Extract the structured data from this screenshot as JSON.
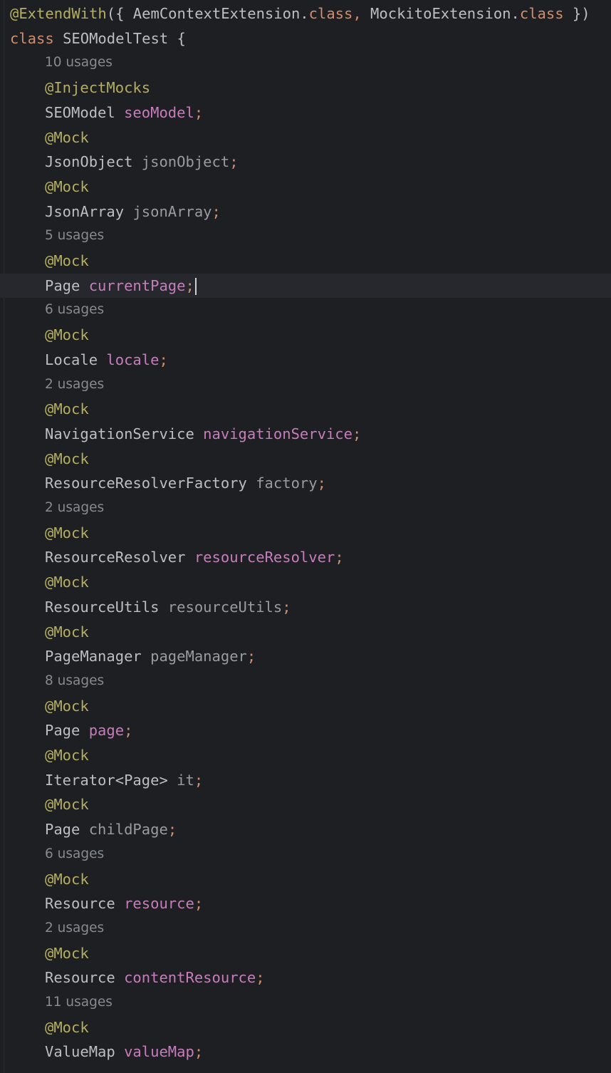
{
  "class_header": {
    "annotation": "@ExtendWith",
    "open": "({ ",
    "ext1": "AemContextExtension",
    "dot1": ".",
    "class_kw1": "class",
    "comma": ", ",
    "ext2": "MockitoExtension",
    "dot2": ".",
    "class_kw2": "class",
    "close": " })",
    "keyword": "class",
    "name": "SEOModelTest",
    "brace": " {"
  },
  "members": [
    {
      "hint": "10 usages",
      "annotation": "@InjectMocks",
      "type": "SEOModel",
      "name": "seoModel",
      "style": "field"
    },
    {
      "hint": "",
      "annotation": "@Mock",
      "type": "JsonObject",
      "name": "jsonObject",
      "style": "dim"
    },
    {
      "hint": "",
      "annotation": "@Mock",
      "type": "JsonArray",
      "name": "jsonArray",
      "style": "dim"
    },
    {
      "hint": "5 usages",
      "annotation": "@Mock",
      "type": "Page",
      "name": "currentPage",
      "style": "field"
    },
    {
      "hint": "6 usages",
      "annotation": "@Mock",
      "type": "Locale",
      "name": "locale",
      "style": "field"
    },
    {
      "hint": "2 usages",
      "annotation": "@Mock",
      "type": "NavigationService",
      "name": "navigationService",
      "style": "field"
    },
    {
      "hint": "",
      "annotation": "@Mock",
      "type": "ResourceResolverFactory",
      "name": "factory",
      "style": "dim"
    },
    {
      "hint": "2 usages",
      "annotation": "@Mock",
      "type": "ResourceResolver",
      "name": "resourceResolver",
      "style": "field"
    },
    {
      "hint": "",
      "annotation": "@Mock",
      "type": "ResourceUtils",
      "name": "resourceUtils",
      "style": "dim"
    },
    {
      "hint": "",
      "annotation": "@Mock",
      "type": "PageManager",
      "name": "pageManager",
      "style": "dim"
    },
    {
      "hint": "8 usages",
      "annotation": "@Mock",
      "type": "Page",
      "name": "page",
      "style": "field"
    },
    {
      "hint": "",
      "annotation": "@Mock",
      "type": "Iterator<Page>",
      "name": "it",
      "style": "dim"
    },
    {
      "hint": "",
      "annotation": "@Mock",
      "type": "Page",
      "name": "childPage",
      "style": "dim"
    },
    {
      "hint": "6 usages",
      "annotation": "@Mock",
      "type": "Resource",
      "name": "resource",
      "style": "field"
    },
    {
      "hint": "2 usages",
      "annotation": "@Mock",
      "type": "Resource",
      "name": "contentResource",
      "style": "field"
    },
    {
      "hint": "11 usages",
      "annotation": "@Mock",
      "type": "ValueMap",
      "name": "valueMap",
      "style": "field"
    }
  ],
  "semicolon": ";",
  "space": " ",
  "colors": {
    "background": "#1e1f22",
    "annotation": "#b3ae60",
    "keyword": "#cf8e6d",
    "field": "#c77dbb",
    "unused_field": "#9a9ba0",
    "hint": "#868a91",
    "text": "#bcbec4"
  }
}
